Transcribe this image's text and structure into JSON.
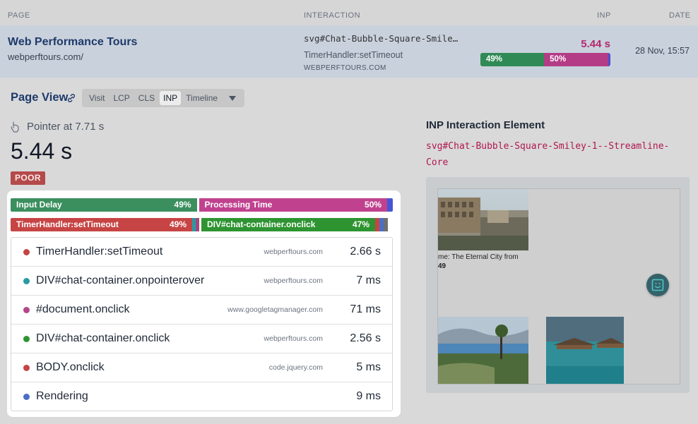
{
  "header": {
    "col_page": "PAGE",
    "col_interaction": "INTERACTION",
    "col_inp": "INP",
    "col_date": "DATE"
  },
  "row": {
    "title": "Web Performance Tours",
    "url": "webperftours.com/",
    "interaction": "svg#Chat-Bubble-Square-Smile…",
    "handler": "TimerHandler:setTimeout",
    "domain": "WEBPERFTOURS.COM",
    "inp": "5.44 s",
    "bar": [
      {
        "label": "49%",
        "fraction": 0.49,
        "color": "#2f8a55"
      },
      {
        "label": "50%",
        "fraction": 0.495,
        "color": "#b43b86"
      },
      {
        "label": "",
        "fraction": 0.015,
        "color": "#4a4fcf"
      }
    ],
    "date": "28 Nov, 15:57"
  },
  "page_view": {
    "title": "Page View",
    "tabs": [
      "Visit",
      "LCP",
      "CLS",
      "INP",
      "Timeline"
    ],
    "active_tab": "INP"
  },
  "summary": {
    "pointer_label": "Pointer at 7.71 s",
    "value": "5.44 s",
    "rating": "POOR"
  },
  "phases": [
    {
      "label": "Input Delay",
      "pct": "49%",
      "fraction": 0.49,
      "color": "#3b8f5e"
    },
    {
      "label": "Processing Time",
      "pct": "50%",
      "fraction": 0.495,
      "color": "#c0428f"
    },
    {
      "label": "",
      "pct": "",
      "fraction": 0.015,
      "color": "#4655d4"
    }
  ],
  "scripts_bar": [
    {
      "label": "TimerHandler:setTimeout",
      "pct": "49%",
      "fraction": 0.475,
      "color": "#c74444"
    },
    {
      "label": "",
      "pct": "",
      "fraction": 0.01,
      "color": "#2a9aa3"
    },
    {
      "label": "",
      "pct": "",
      "fraction": 0.01,
      "color": "#a5467e"
    },
    {
      "label": "DIV#chat-container.onclick",
      "pct": "47%",
      "fraction": 0.455,
      "color": "#2e9431"
    },
    {
      "label": "",
      "pct": "",
      "fraction": 0.012,
      "color": "#c74444"
    },
    {
      "label": "",
      "pct": "",
      "fraction": 0.012,
      "color": "#4a6fc6"
    },
    {
      "label": "",
      "pct": "",
      "fraction": 0.012,
      "color": "#6f6f6f"
    }
  ],
  "items": [
    {
      "name": "TimerHandler:setTimeout",
      "domain": "webperftours.com",
      "duration": "2.66 s",
      "color": "#c74444"
    },
    {
      "name": "DIV#chat-container.onpointerover",
      "domain": "webperftours.com",
      "duration": "7 ms",
      "color": "#2a9aa3"
    },
    {
      "name": "#document.onclick",
      "domain": "www.googletagmanager.com",
      "duration": "71 ms",
      "color": "#b5468a"
    },
    {
      "name": "DIV#chat-container.onclick",
      "domain": "webperftours.com",
      "duration": "2.56 s",
      "color": "#2e9431"
    },
    {
      "name": "BODY.onclick",
      "domain": "code.jquery.com",
      "duration": "5 ms",
      "color": "#c74444"
    },
    {
      "name": "Rendering",
      "domain": "",
      "duration": "9 ms",
      "color": "#4a6fc6"
    }
  ],
  "element": {
    "title": "INP Interaction Element",
    "selector": "svg#Chat-Bubble-Square-Smiley-1--Streamline-Core",
    "preview_text_1": "me: The Eternal City from",
    "preview_text_2": "49"
  }
}
